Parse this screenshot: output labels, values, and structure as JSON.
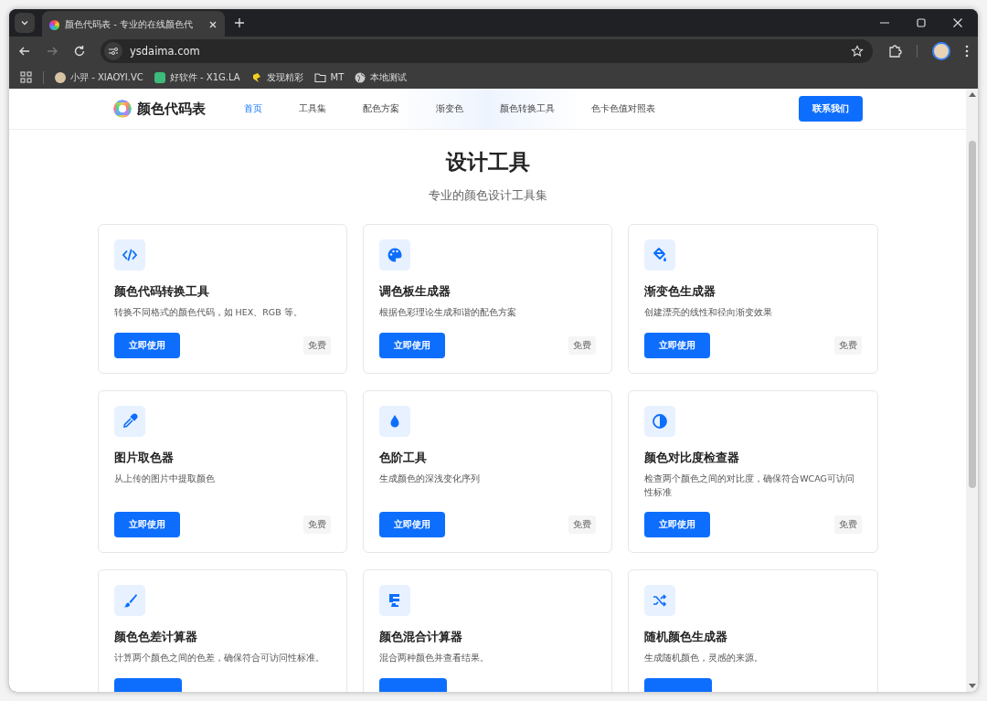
{
  "browser": {
    "tab_title": "颜色代码表 - 专业的在线颜色代",
    "url": "ysdaima.com",
    "bookmarks": [
      {
        "label": "小羿 - XIAOYI.VC",
        "kind": "avatar"
      },
      {
        "label": "好软件 - X1G.LA",
        "kind": "app"
      },
      {
        "label": "发现精彩",
        "kind": "spark"
      },
      {
        "label": "MT",
        "kind": "folder"
      },
      {
        "label": "本地测试",
        "kind": "globe"
      }
    ]
  },
  "site": {
    "logo_text": "颜色代码表",
    "nav": [
      {
        "label": "首页",
        "selected": true
      },
      {
        "label": "工具集",
        "selected": false
      },
      {
        "label": "配色方案",
        "selected": false
      },
      {
        "label": "渐变色",
        "selected": false
      },
      {
        "label": "颜色转换工具",
        "selected": false
      },
      {
        "label": "色卡色值对照表",
        "selected": false
      }
    ],
    "contact_button": "联系我们",
    "heading": "设计工具",
    "subheading": "专业的颜色设计工具集",
    "tools": [
      {
        "kind": "code",
        "title": "颜色代码转换工具",
        "description": "转换不同格式的颜色代码，如 HEX、RGB 等。",
        "button": "立即使用",
        "badge": "免费"
      },
      {
        "kind": "palette",
        "title": "调色板生成器",
        "description": "根据色彩理论生成和谐的配色方案",
        "button": "立即使用",
        "badge": "免费"
      },
      {
        "kind": "fill",
        "title": "渐变色生成器",
        "description": "创建漂亮的线性和径向渐变效果",
        "button": "立即使用",
        "badge": "免费"
      },
      {
        "kind": "eyedropper",
        "title": "图片取色器",
        "description": "从上传的图片中提取颜色",
        "button": "立即使用",
        "badge": "免费"
      },
      {
        "kind": "drop",
        "title": "色阶工具",
        "description": "生成颜色的深浅变化序列",
        "button": "立即使用",
        "badge": "免费"
      },
      {
        "kind": "contrast",
        "title": "颜色对比度检查器",
        "description": "检查两个颜色之间的对比度，确保符合WCAG可访问性标准",
        "button": "立即使用",
        "badge": "免费"
      },
      {
        "kind": "brush",
        "title": "颜色色差计算器",
        "description": "计算两个颜色之间的色差，确保符合可访问性标准。"
      },
      {
        "kind": "mixer",
        "title": "颜色混合计算器",
        "description": "混合两种颜色并查看结果。"
      },
      {
        "kind": "shuffle",
        "title": "随机颜色生成器",
        "description": "生成随机颜色，灵感的来源。"
      }
    ]
  }
}
